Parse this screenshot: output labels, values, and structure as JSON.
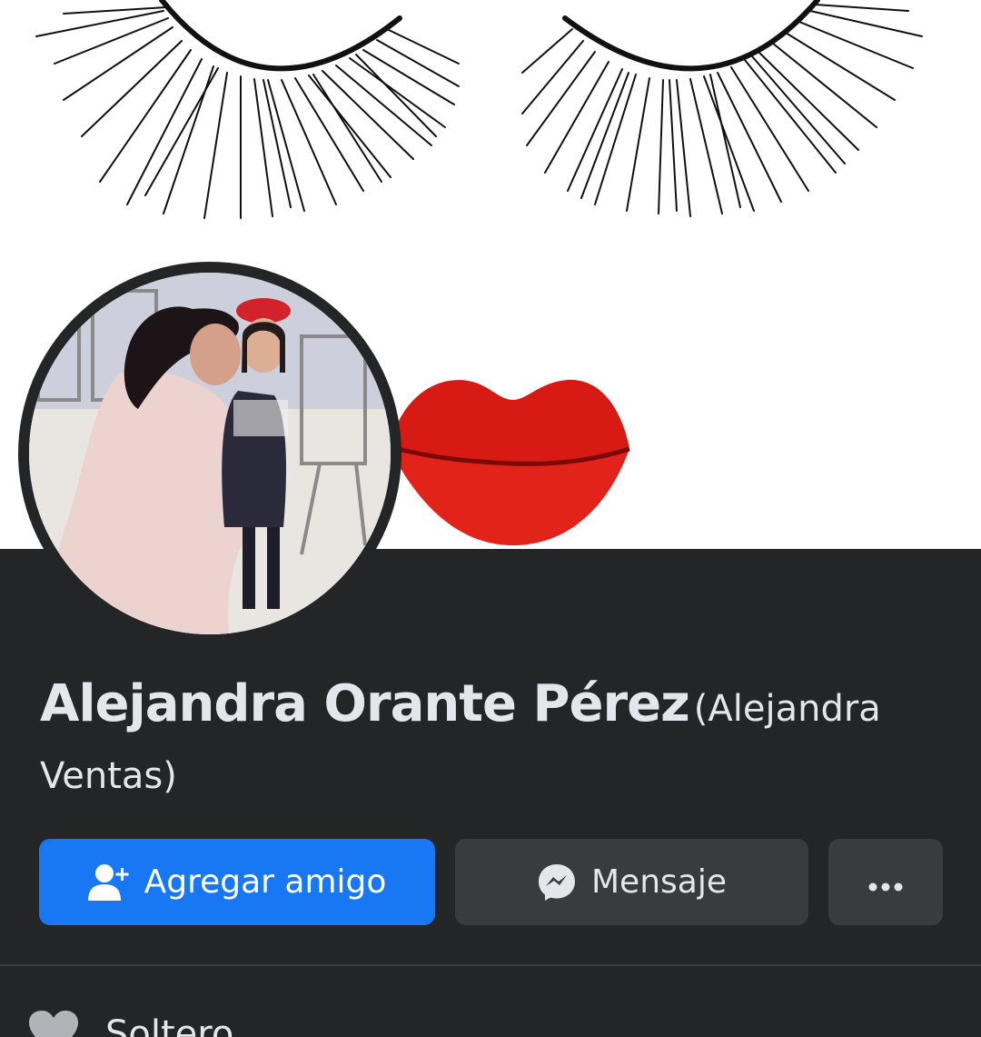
{
  "profile": {
    "name": "Alejandra Orante Pérez",
    "alternate_name_line1": "(Alejandra",
    "alternate_name_line2": "Ventas)"
  },
  "actions": {
    "add_friend_label": "Agregar amigo",
    "message_label": "Mensaje",
    "more_icon": "ellipsis-icon"
  },
  "intro": {
    "relationship_label": "Soltero"
  },
  "colors": {
    "background": "#242526",
    "primary_button": "#1877f2",
    "secondary_button": "#3a3b3c",
    "text": "#e4e6eb"
  }
}
